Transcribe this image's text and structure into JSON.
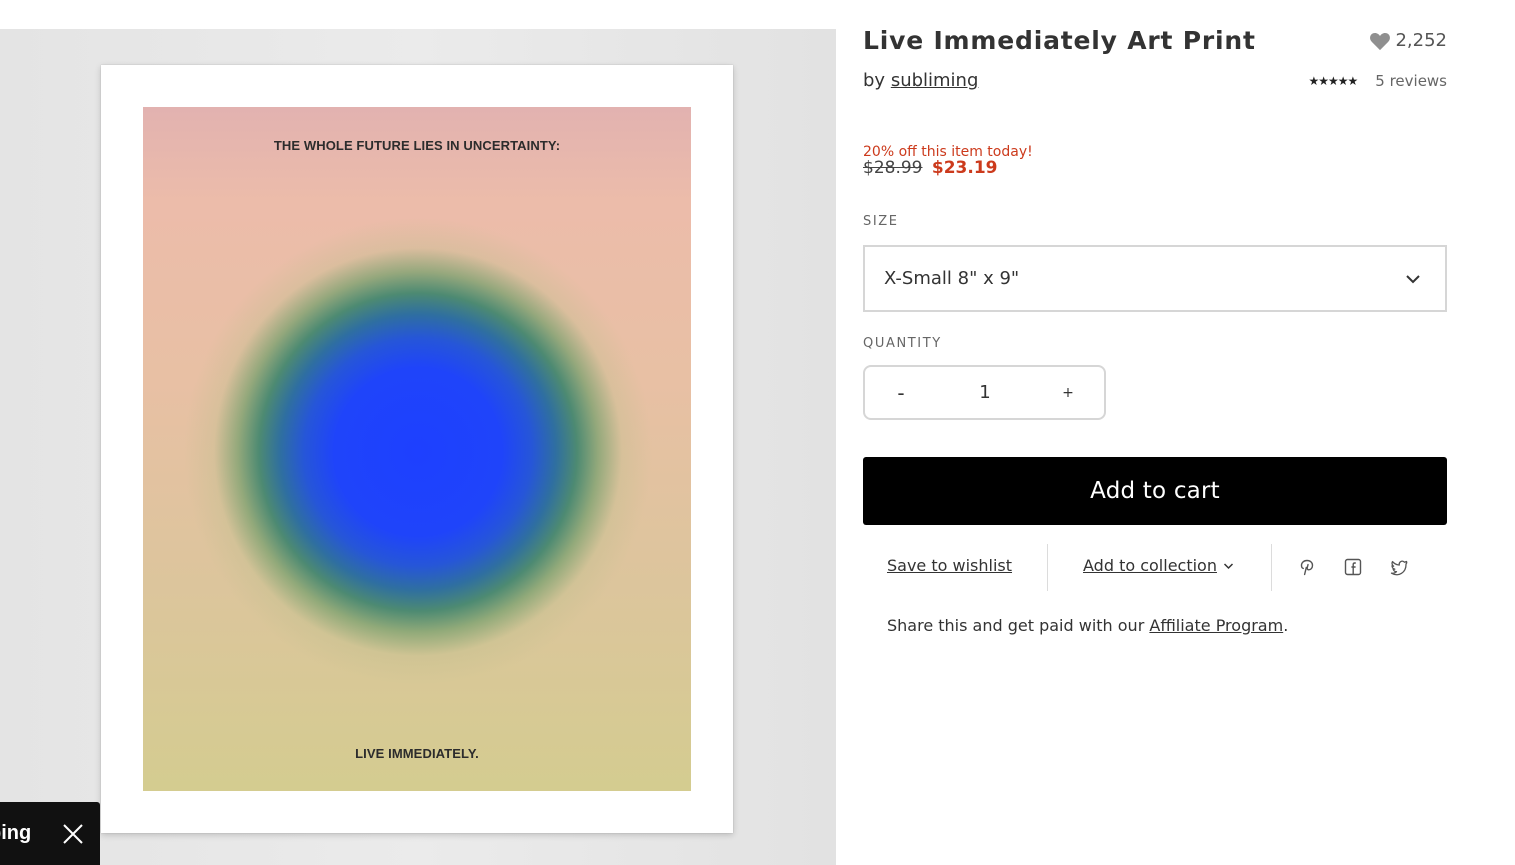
{
  "artwork": {
    "top_text": "THE WHOLE FUTURE LIES IN UNCERTAINTY:",
    "bottom_text": "LIVE IMMEDIATELY."
  },
  "toast": {
    "text": "ping"
  },
  "product": {
    "title": "Live Immediately Art Print",
    "likes": "2,252",
    "by_prefix": "by",
    "artist": "subliming",
    "stars": "★★★★★",
    "reviews": "5 reviews",
    "discount_text": "20% off this item today!",
    "old_price": "$28.99",
    "new_price": "$23.19"
  },
  "size": {
    "label": "SIZE",
    "selected": "X-Small 8\" x 9\""
  },
  "quantity": {
    "label": "QUANTITY",
    "minus": "-",
    "value": "1",
    "plus": "+"
  },
  "cart": {
    "label": "Add to cart"
  },
  "actions": {
    "wishlist": "Save to wishlist",
    "collection": "Add to collection"
  },
  "affiliate": {
    "prefix": "Share this and get paid with our",
    "link": "Affiliate Program",
    "suffix": "."
  },
  "colors": {
    "sale": "#cc3a1c",
    "button": "#000000",
    "orb": "#1e40ff"
  }
}
